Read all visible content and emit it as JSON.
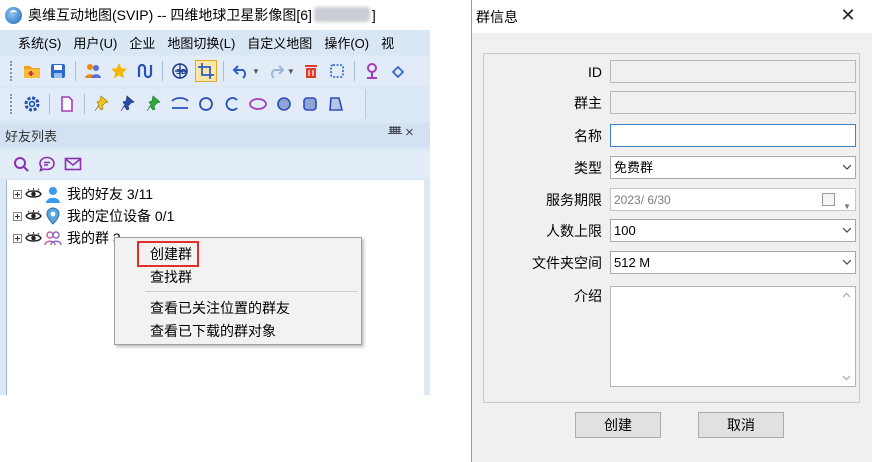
{
  "main_window": {
    "title_prefix": "奥维互动地图(SVIP) -- 四维地球卫星影像图[6]",
    "title_suffix": "]",
    "menu": [
      "系统(S)",
      "用户(U)",
      "企业",
      "地图切换(L)",
      "自定义地图",
      "操作(O)",
      "视"
    ],
    "toolbar1_icons": [
      "open-folder-icon",
      "save-icon",
      "users-icon",
      "star-icon",
      "route-icon",
      "globe-3d-icon",
      "crop-icon",
      "undo-icon",
      "redo-icon",
      "delete-icon",
      "select-rect-icon",
      "pin-user-icon",
      "eraser-icon"
    ],
    "toolbar2_icons": [
      "settings-gear-icon",
      "document-icon",
      "pushpin-yellow-icon",
      "pushpin-blue-icon",
      "pushpin-green-icon",
      "polyline-icon",
      "circle-icon",
      "arc-icon",
      "ellipse-icon",
      "circle-filled-icon",
      "square-rounded-icon",
      "polygon-icon"
    ],
    "panel": {
      "title": "好友列表",
      "pin_glyph": "ᚙ",
      "close_glyph": "×",
      "tools": [
        "search-icon",
        "chat-icon",
        "mail-icon"
      ]
    },
    "tree": [
      {
        "label": "我的好友 3/11",
        "icon": "friend-icon"
      },
      {
        "label": "我的定位设备 0/1",
        "icon": "location-device-icon"
      },
      {
        "label": "我的群 3",
        "icon": "group-icon"
      }
    ],
    "context_menu": {
      "items": [
        "创建群",
        "查找群",
        "查看已关注位置的群友",
        "查看已下载的群对象"
      ],
      "highlighted": "创建群"
    }
  },
  "dialog": {
    "title": "群信息",
    "close_glyph": "✕",
    "fields": {
      "id_label": "ID",
      "id_value": "",
      "owner_label": "群主",
      "owner_value": "",
      "name_label": "名称",
      "name_value": "",
      "type_label": "类型",
      "type_value": "免费群",
      "service_label": "服务期限",
      "service_value": "2023/  6/30",
      "limit_label": "人数上限",
      "limit_value": "100",
      "folder_label": "文件夹空间",
      "folder_value": "512 M",
      "intro_label": "介绍",
      "intro_value": ""
    },
    "buttons": {
      "create": "创建",
      "cancel": "取消"
    }
  }
}
